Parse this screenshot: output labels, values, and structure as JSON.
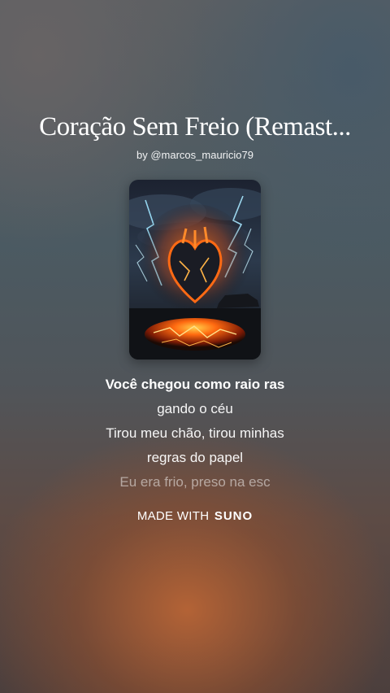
{
  "song": {
    "title": "Coração Sem Freio (Remast...",
    "byline": "by @marcos_mauricio79"
  },
  "lyrics": {
    "lines": [
      "Você chegou como raio ras",
      "gando o céu",
      "Tirou meu chão, tirou minhas",
      "regras do papel",
      "Eu era frio, preso na esc"
    ]
  },
  "footer": {
    "made_with": "MADE WITH",
    "brand": "SUNO"
  },
  "cover_art": {
    "icon": "flaming-heart-lightning-artwork"
  }
}
